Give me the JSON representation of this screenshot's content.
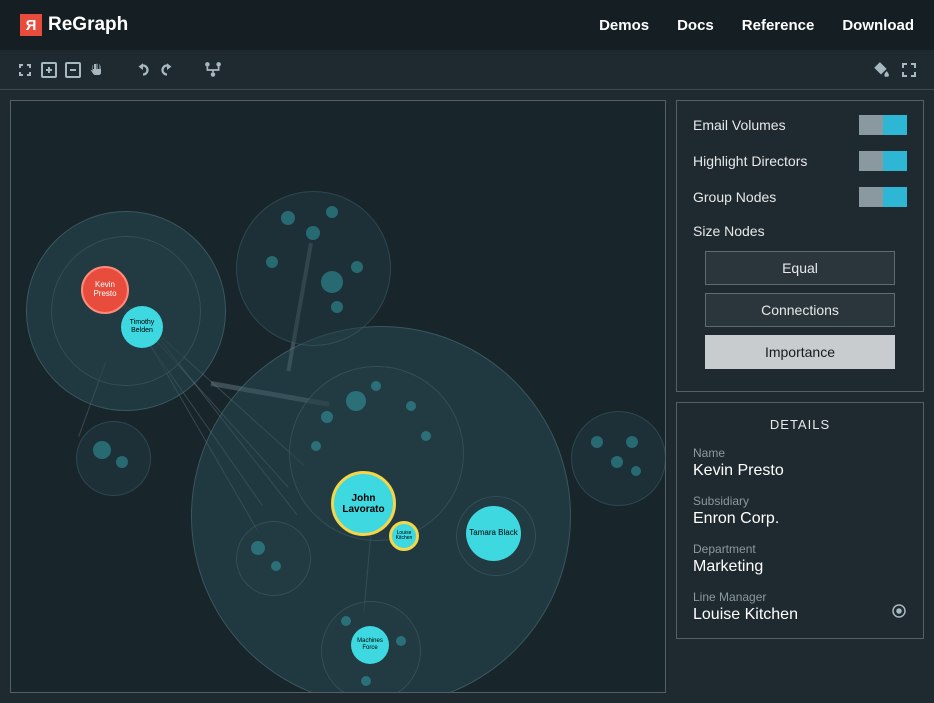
{
  "header": {
    "logo_text": "ReGraph",
    "logo_glyph": "Я",
    "nav": [
      "Demos",
      "Docs",
      "Reference",
      "Download"
    ]
  },
  "toolbar": {
    "fit": "fit-icon",
    "zoom_in": "zoom-in-icon",
    "zoom_out": "zoom-out-icon",
    "pan": "pan-icon",
    "undo": "undo-icon",
    "redo": "redo-icon",
    "layout": "layout-icon",
    "fill": "fill-icon",
    "fullscreen": "fullscreen-icon"
  },
  "controls": {
    "email_volumes": {
      "label": "Email Volumes",
      "on": true
    },
    "highlight_directors": {
      "label": "Highlight Directors",
      "on": true
    },
    "group_nodes": {
      "label": "Group Nodes",
      "on": true
    },
    "size_nodes_label": "Size Nodes",
    "size_options": [
      {
        "label": "Equal",
        "active": false
      },
      {
        "label": "Connections",
        "active": false
      },
      {
        "label": "Importance",
        "active": true
      }
    ]
  },
  "details": {
    "title": "DETAILS",
    "fields": [
      {
        "label": "Name",
        "value": "Kevin Presto"
      },
      {
        "label": "Subsidiary",
        "value": "Enron Corp."
      },
      {
        "label": "Department",
        "value": "Marketing"
      },
      {
        "label": "Line Manager",
        "value": "Louise Kitchen"
      }
    ]
  },
  "graph": {
    "labeled_nodes": {
      "kevin_presto": "Kevin Presto",
      "timothy_belden": "Timothy Belden",
      "john_lavorato": "John Lavorato",
      "tamara_black": "Tamara Black",
      "louise_kitchen": "Louise Kitchen",
      "machines_force": "Machines Force"
    }
  }
}
